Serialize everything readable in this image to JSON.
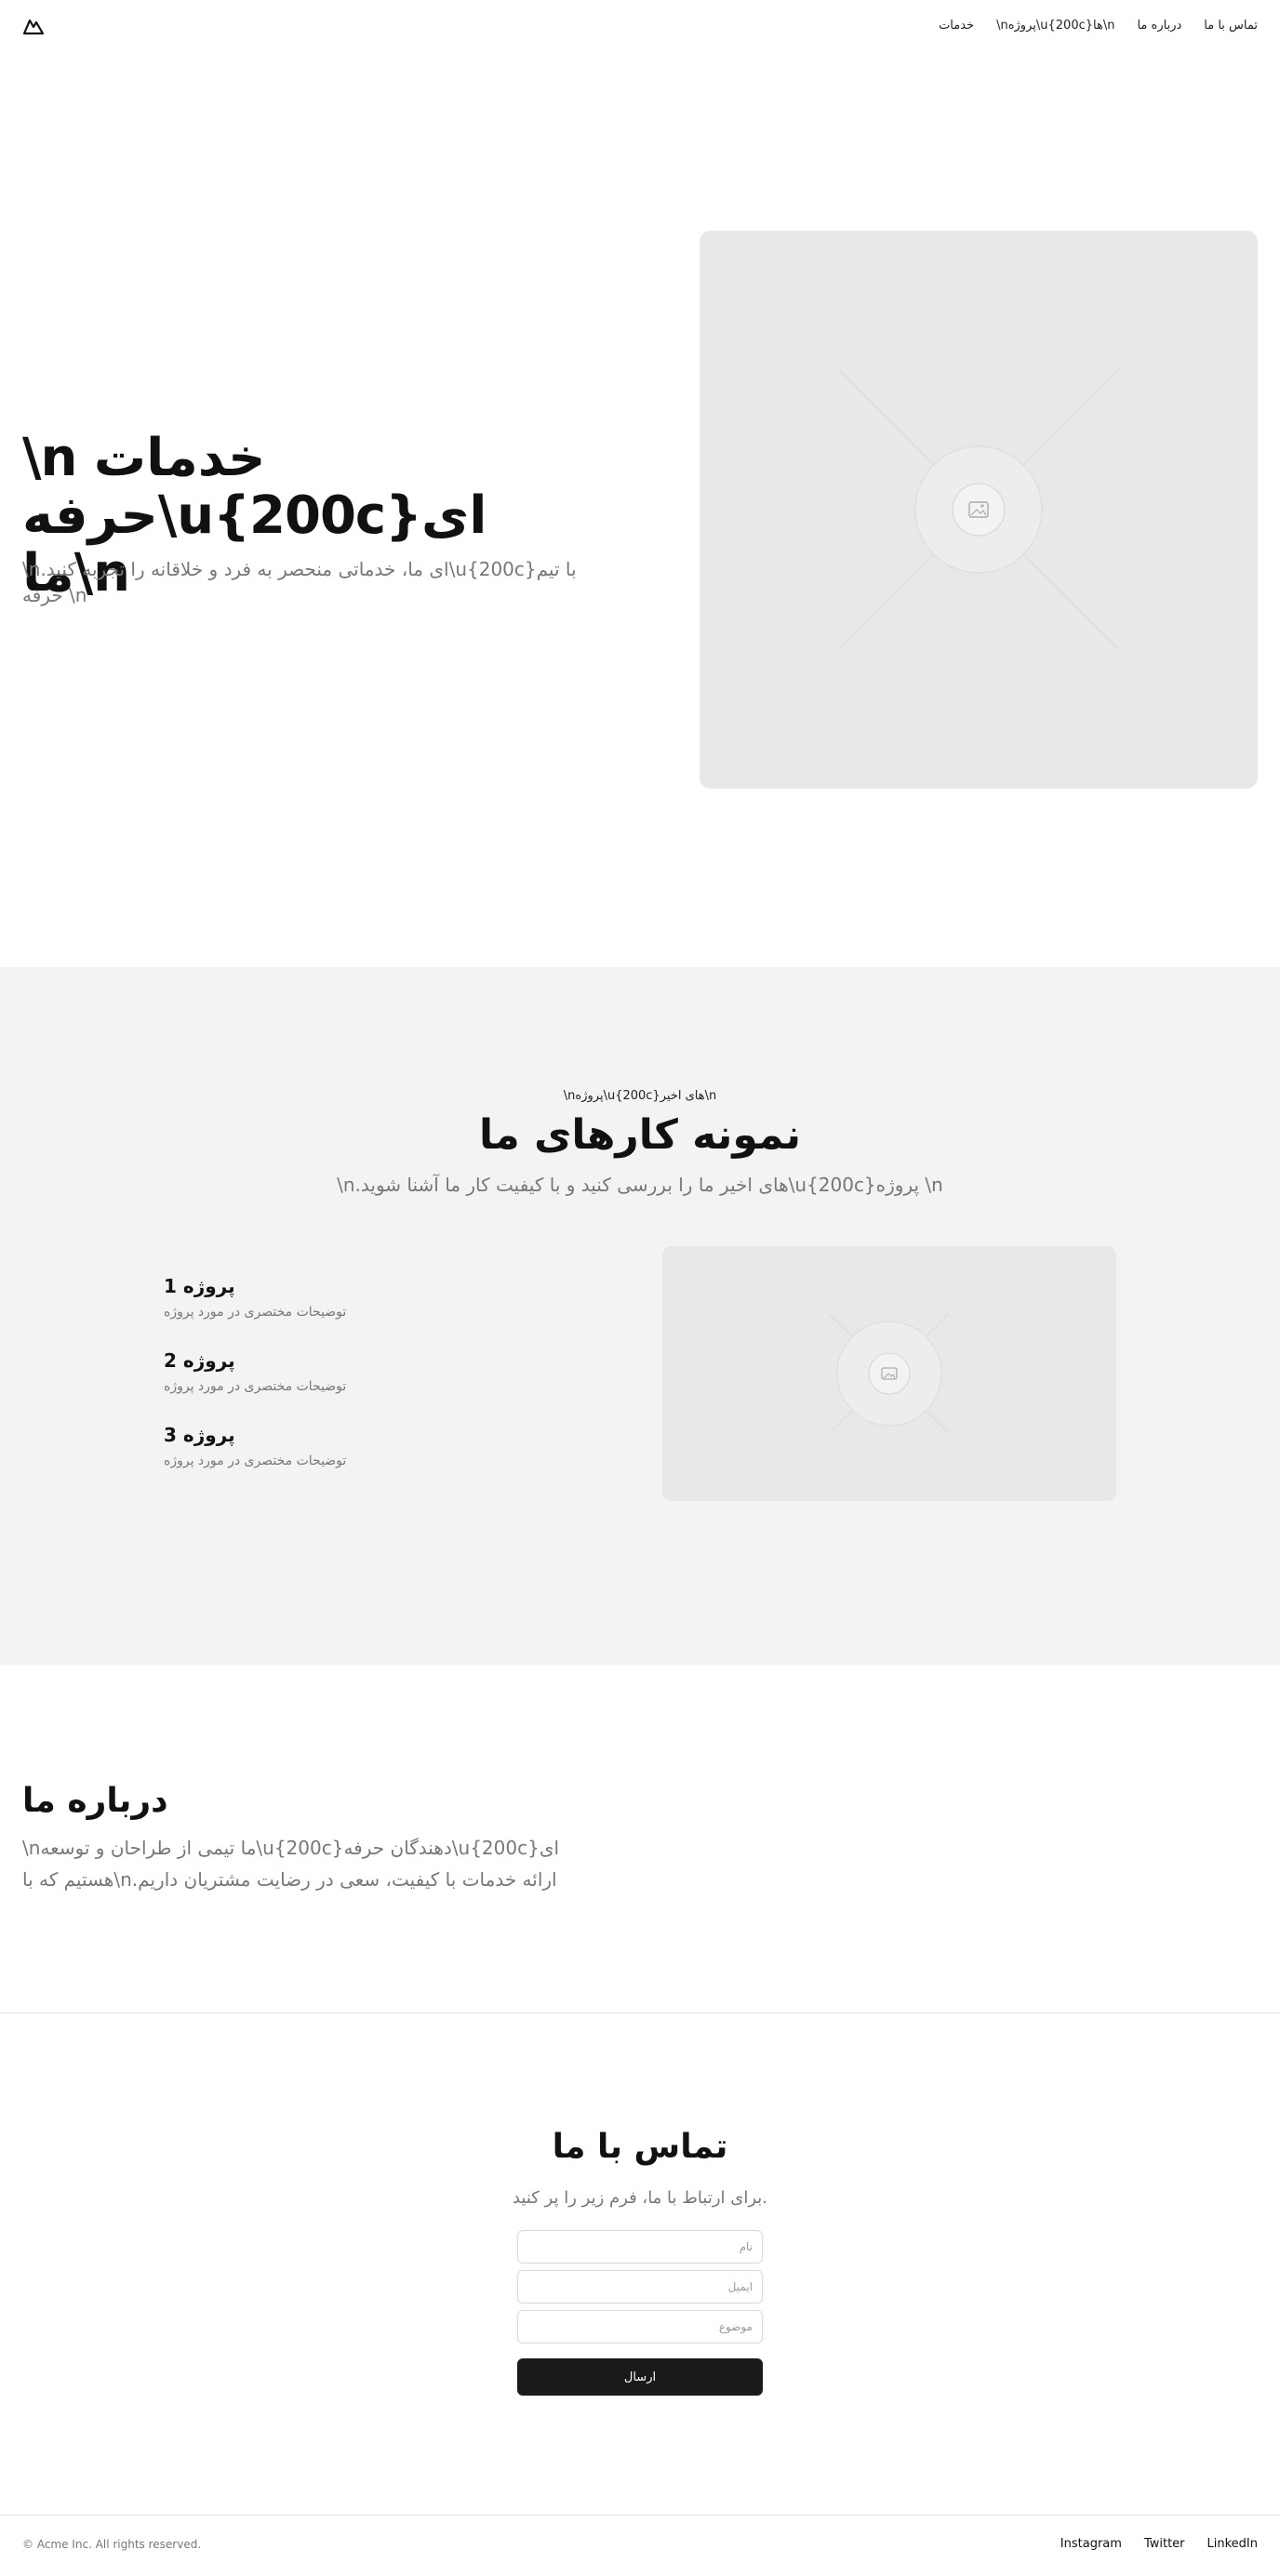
{
  "header": {
    "logo_icon": "mountain-icon",
    "nav": [
      {
        "label": "خدمات"
      },
      {
        "label": "\\nپروژه\\u{200c}ها\\n"
      },
      {
        "label": "درباره ما"
      },
      {
        "label": "تماس با ما"
      }
    ]
  },
  "hero": {
    "title": "\\n خدمات حرفه\\u{200c}ای ما\\n",
    "subtitle": "\\n.ای ما، خدماتی منحصر به فرد و خلاقانه را تجربه کنید\\u{200c}با تیم حرفه \\n",
    "image_icon": "image-placeholder-icon"
  },
  "work": {
    "kicker": "\\nپروژه\\u{200c}های اخیر\\n",
    "title": "نمونه کارهای ما",
    "subtitle": "\\n.های اخیر ما را بررسی کنید و با کیفیت کار ما آشنا شوید\\u{200c}پروژه \\n",
    "projects": [
      {
        "title": "پروژه 1",
        "desc": "توضیحات مختصری در مورد پروژه"
      },
      {
        "title": "پروژه 2",
        "desc": "توضیحات مختصری در مورد پروژه"
      },
      {
        "title": "پروژه 3",
        "desc": "توضیحات مختصری در مورد پروژه"
      }
    ],
    "image_icon": "image-placeholder-icon"
  },
  "about": {
    "title": "درباره ما",
    "text": "\\nما تیمی از طراحان و توسعه\\u{200c}دهندگان حرفه\\u{200c}ای هستیم که با\\n.ارائه خدمات با کیفیت، سعی در رضایت مشتریان داریم"
  },
  "contact": {
    "title": "تماس با ما",
    "subtitle": "برای ارتباط با ما، فرم زیر را پر کنید.",
    "name_placeholder": "نام",
    "email_placeholder": "ایمیل",
    "subject_placeholder": "موضوع",
    "submit_label": "ارسال"
  },
  "footer": {
    "copyright": "© Acme Inc. All rights reserved.",
    "links": [
      {
        "label": "Instagram"
      },
      {
        "label": "Twitter"
      },
      {
        "label": "LinkedIn"
      }
    ]
  },
  "colors": {
    "background": "#ffffff",
    "section_gray": "#f2f3f5",
    "placeholder_gray": "#e8e8e8",
    "button_dark": "#1a1a1a",
    "muted_text": "#777777"
  }
}
